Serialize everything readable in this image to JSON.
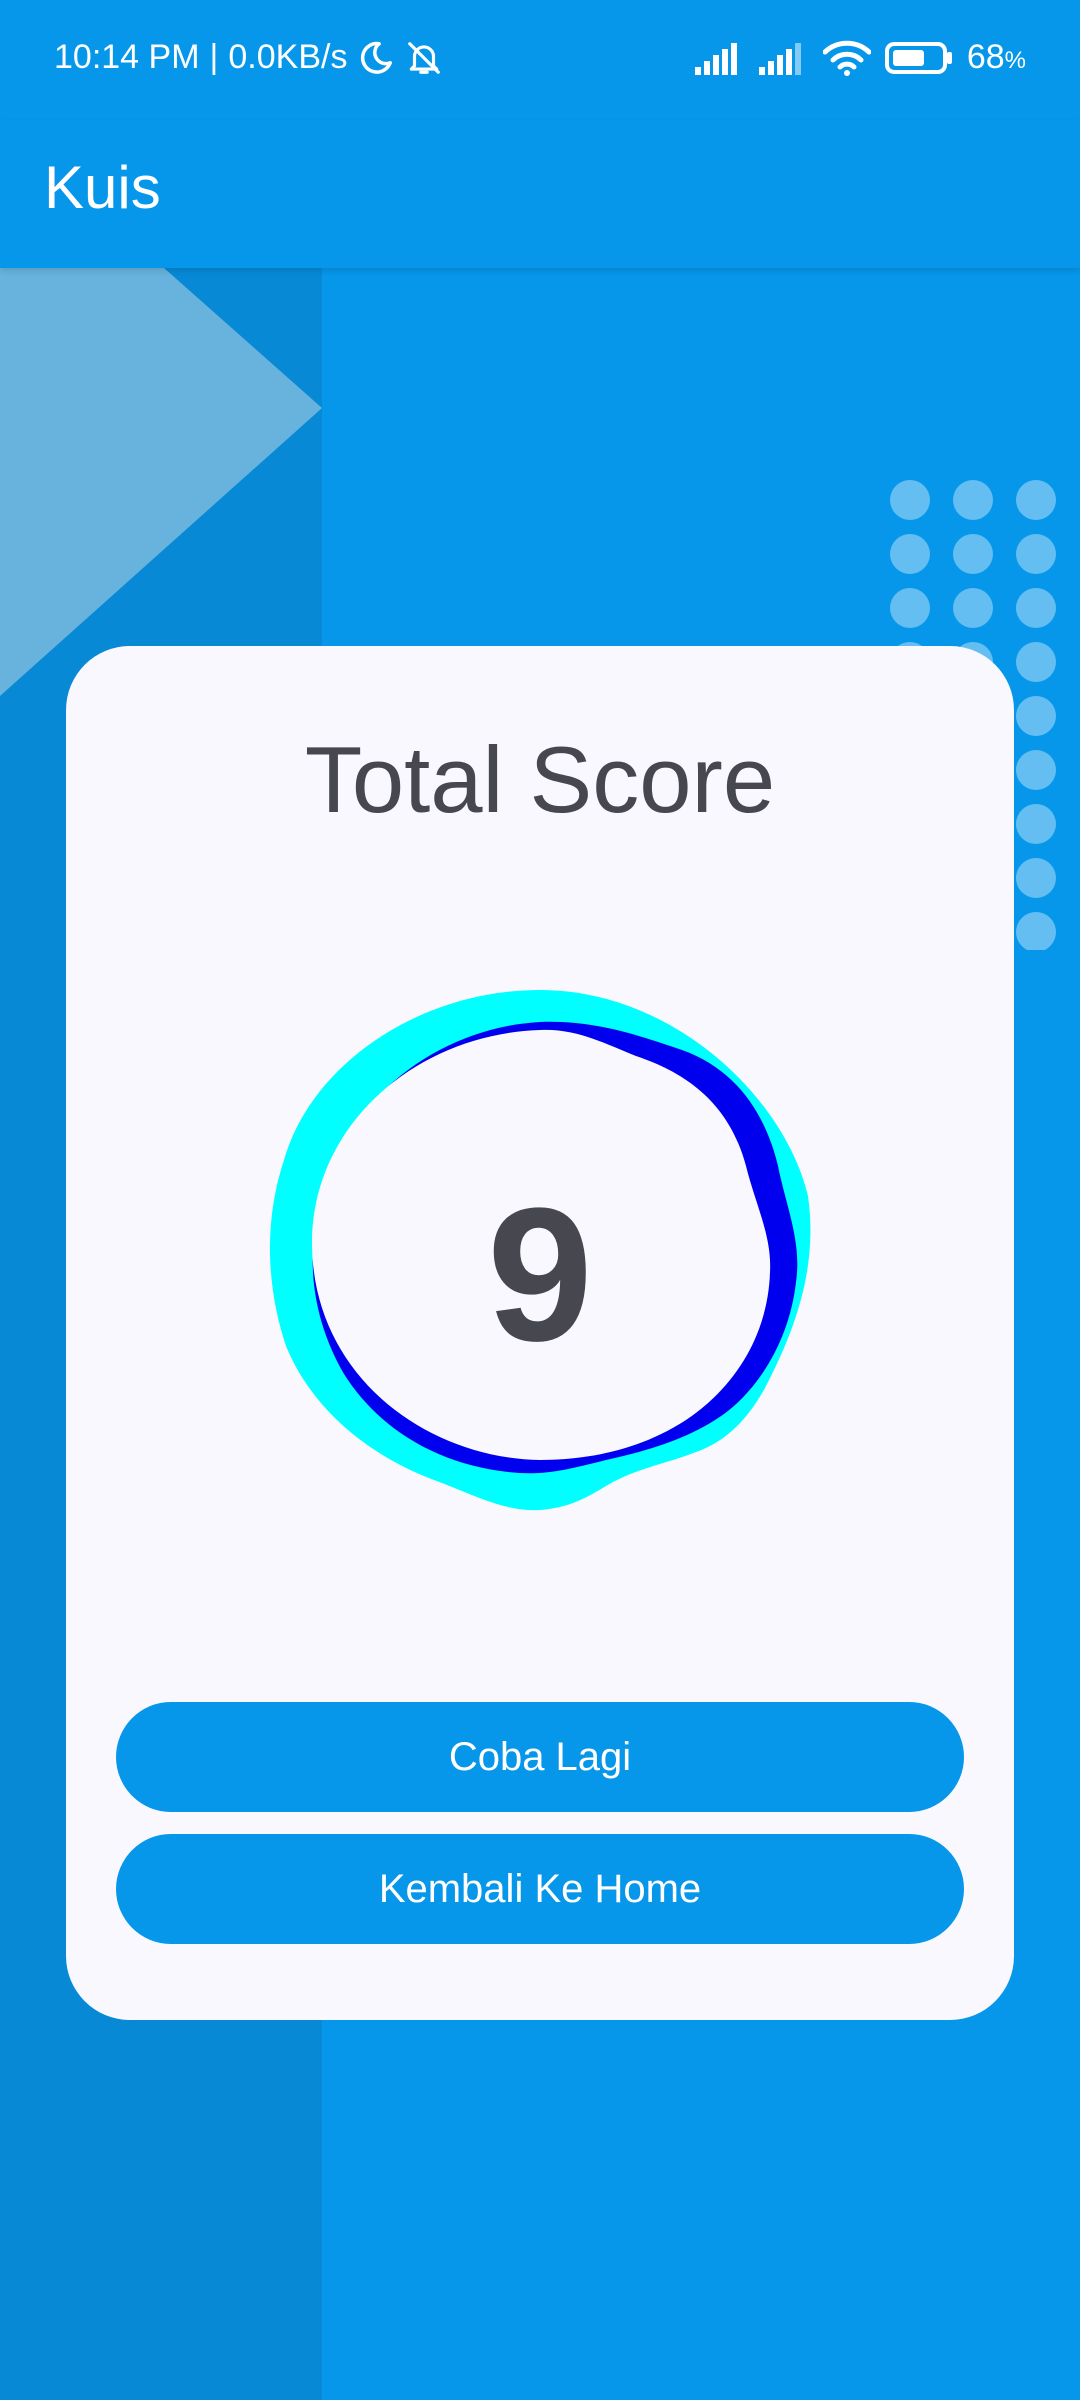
{
  "status_bar": {
    "time": "10:14 PM",
    "separator": "|",
    "network_speed": "0.0KB/s",
    "battery_percent": "68",
    "battery_unit": "%",
    "battery_level": 0.68,
    "icons": [
      "moon-icon",
      "bell-off-icon",
      "signal-icon",
      "signal-icon",
      "wifi-icon",
      "battery-icon"
    ]
  },
  "app_bar": {
    "title": "Kuis"
  },
  "result_card": {
    "title": "Total Score",
    "score": "9",
    "retry_button": "Coba Lagi",
    "home_button": "Kembali Ke Home"
  },
  "colors": {
    "primary": "#0797EA",
    "card_background": "#F9F8FE",
    "text_dark": "#47474F",
    "ring_outer": "#00FFFF",
    "ring_inner": "#0000FF"
  }
}
